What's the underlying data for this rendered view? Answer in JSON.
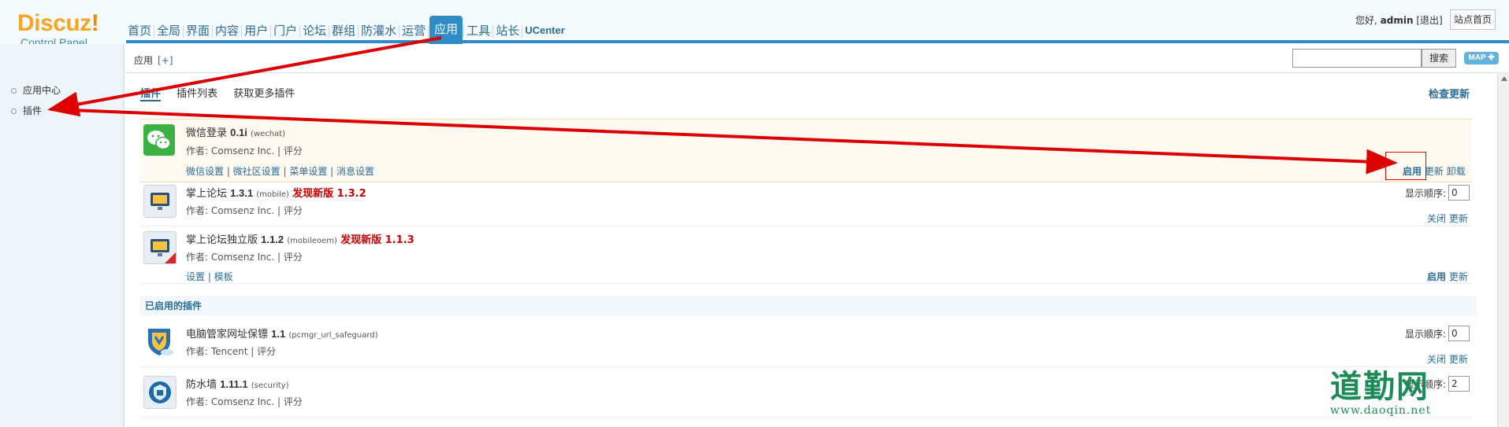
{
  "header": {
    "logo_title": "Discuz",
    "logo_bang": "!",
    "logo_sub": "Control Panel",
    "nav": [
      "首页",
      "全局",
      "界面",
      "内容",
      "用户",
      "门户",
      "论坛",
      "群组",
      "防灌水",
      "运营",
      "应用",
      "工具",
      "站长",
      "UCenter"
    ],
    "active_nav": "应用",
    "greeting": "您好,",
    "username": "admin",
    "logout": "[退出]",
    "site_home": "站点首页"
  },
  "sidebar": {
    "items": [
      {
        "label": "应用中心"
      },
      {
        "label": "插件"
      }
    ]
  },
  "subheader": {
    "breadcrumb": "应用",
    "add": "[+]",
    "search_value": "",
    "search_button": "搜索",
    "map_button": "MAP ✚"
  },
  "main": {
    "tabs": [
      "插件",
      "插件列表",
      "获取更多插件"
    ],
    "check_update": "检查更新",
    "plugins": [
      {
        "name": "微信登录",
        "version": "0.1i",
        "ident": "(wechat)",
        "author": "作者: Comsenz Inc.  |  评分",
        "links": "微信设置 | 微社区设置 | 菜单设置 | 消息设置",
        "actions": [
          "启用",
          "更新",
          "卸载"
        ]
      },
      {
        "name": "掌上论坛",
        "version": "1.3.1",
        "ident": "(mobile)",
        "newver": "发现新版  1.3.2",
        "author": "作者: Comsenz Inc.  |  评分",
        "order_label": "显示顺序:",
        "order_value": "0",
        "actions": [
          "关闭",
          "更新"
        ]
      },
      {
        "name": "掌上论坛独立版",
        "version": "1.1.2",
        "ident": "(mobileoem)",
        "newver": "发现新版  1.1.3",
        "author": "作者: Comsenz Inc.  |  评分",
        "links": "设置 | 模板",
        "actions": [
          "启用",
          "更新"
        ]
      }
    ],
    "enabled_section": "已启用的插件",
    "enabled_plugins": [
      {
        "name": "电脑管家网址保镖",
        "version": "1.1",
        "ident": "(pcmgr_url_safeguard)",
        "author": "作者: Tencent  |  评分",
        "order_label": "显示顺序:",
        "order_value": "0",
        "actions": [
          "关闭",
          "更新"
        ]
      },
      {
        "name": "防水墙",
        "version": "1.11.1",
        "ident": "(security)",
        "author": "作者: Comsenz Inc.  |  评分",
        "order_label": "显示顺序:",
        "order_value": "2"
      }
    ]
  },
  "watermark": {
    "main": "道勤网",
    "sub": "www.daoqin.net"
  },
  "colors": {
    "accent": "#2f8cc6",
    "link": "#2b6c9a",
    "logo": "#f5a623",
    "annotation_red": "#dd0000",
    "new_version_red": "#cc0000",
    "watermark_green": "#1b8b57"
  }
}
